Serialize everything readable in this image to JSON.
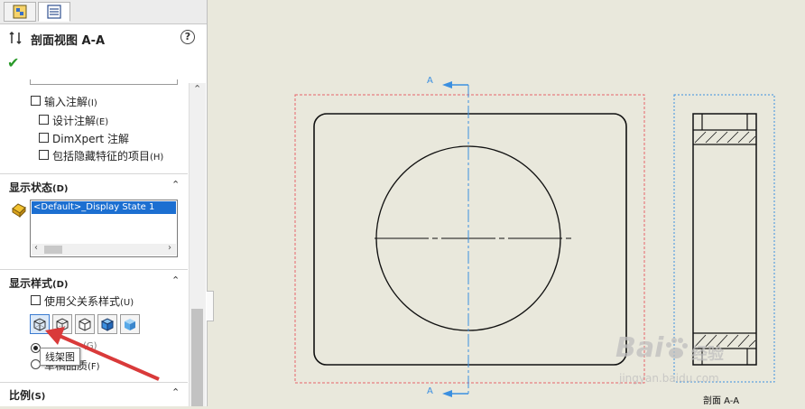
{
  "property_manager": {
    "title": "剖面视图 A-A",
    "help_glyph": "?",
    "ok_glyph": "✔"
  },
  "annotations": {
    "import_label": "输入注解",
    "import_key": "(I)",
    "design_label": "设计注解",
    "design_key": "(E)",
    "dimxpert_label": "DimXpert 注解",
    "hidden_label": "包括隐藏特征的项目",
    "hidden_key": "(H)"
  },
  "display_state": {
    "header": "显示状态",
    "header_key": "(D)",
    "items": [
      "<Default>_Display State 1"
    ]
  },
  "display_style": {
    "header": "显示样式",
    "header_key": "(D)",
    "use_parent_label": "使用父关系样式",
    "use_parent_key": "(U)",
    "tooltip": "线架图",
    "radio1_key": "(G)",
    "radio2_label": "草稿品质",
    "radio2_key": "(F)"
  },
  "scale": {
    "header": "比例",
    "header_key": "(S)"
  },
  "drawing": {
    "arrow_label_top": "A",
    "arrow_label_bottom": "A",
    "section_caption": "剖面 A-A"
  },
  "watermark": {
    "brand": "Bai",
    "brand_suffix": "经验",
    "url": "jingyan.baidu.com"
  },
  "colors": {
    "selection": "#1c6fd1",
    "accent_blue": "#3b8fe0",
    "view_border": "#e8646a",
    "canvas_bg": "#e9e8dc",
    "pointer_arrow": "#d93a3a"
  }
}
